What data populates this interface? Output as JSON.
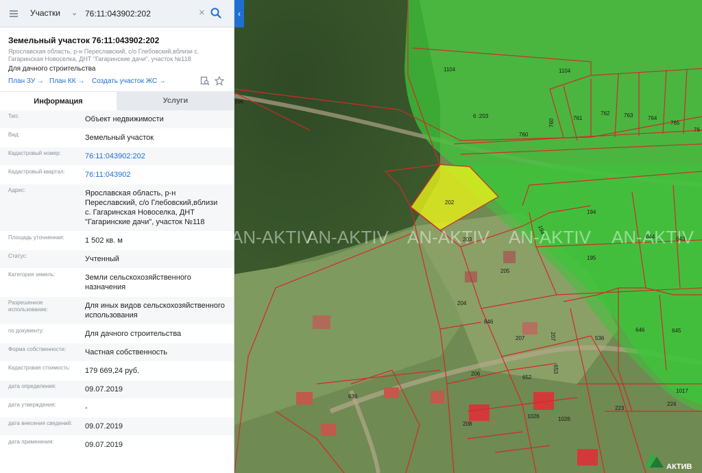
{
  "search": {
    "category": "Участки",
    "query": "76:11:043902:202"
  },
  "parcel": {
    "title": "Земельный участок 76:11:043902:202",
    "address_sub": "Ярославская область, р-н Переславский, с/о Глебовский,вблизи с. Гагаринская Новоселка, ДНТ \"Гагаринские дачи\", участок №118",
    "usage": "Для дачного строительства",
    "links": {
      "plan_zu": "План ЗУ →",
      "plan_kk": "План КК →",
      "create": "Создать участок ЖС →"
    }
  },
  "tabs": {
    "info": "Информация",
    "services": "Услуги"
  },
  "rows": [
    {
      "label": "Тип:",
      "value": "Объект недвижимости"
    },
    {
      "label": "Вид:",
      "value": "Земельный участок"
    },
    {
      "label": "Кадастровый номер:",
      "value": "76:11:043902:202"
    },
    {
      "label": "Кадастровый квартал:",
      "value": "76:11:043902"
    },
    {
      "label": "Адрес:",
      "value": "Ярославская область, р-н Переславский, с/о Глебовский,вблизи с. Гагаринская Новоселка, ДНТ \"Гагаринские дачи\", участок №118"
    },
    {
      "label": "Площадь уточненная:",
      "value": "1 502 кв. м"
    },
    {
      "label": "Статус:",
      "value": "Учтенный"
    },
    {
      "label": "Категория земель:",
      "value": "Земли сельскохозяйственного назначения"
    },
    {
      "label": "Разрешенное использование:",
      "value": "Для иных видов сельскохозяйственного использования"
    },
    {
      "label": "по документу:",
      "value": "Для дачного строительства"
    },
    {
      "label": "Форма собственности:",
      "value": "Частная собственность"
    },
    {
      "label": "Кадастровая стоимость:",
      "value": "179 669,24 руб."
    },
    {
      "label": "дата определения:",
      "value": "09.07.2019"
    },
    {
      "label": "дата утверждения:",
      "value": "-"
    },
    {
      "label": "дата внесения сведений:",
      "value": "09.07.2019"
    },
    {
      "label": "дата применения:",
      "value": "09.07.2019"
    }
  ],
  "map": {
    "watermark": "AN-AKTIV",
    "logo_text": "АКТИВ",
    "parcel_labels": [
      "1104",
      "1104",
      "6 :203",
      "760",
      "760",
      "761",
      "762",
      "763",
      "764",
      "765",
      "76",
      "996",
      "202",
      "203",
      "194",
      "194",
      "195",
      "644",
      "643",
      "205",
      "204",
      "846",
      "207",
      "207",
      "536",
      "646",
      "645",
      "206",
      "652",
      "653",
      "639",
      "1026",
      "1026",
      "208",
      "223",
      "224",
      "1017"
    ],
    "colors": {
      "zone_green": "#3ec43a",
      "selected": "#e8f21a",
      "border": "#d22a2a"
    }
  }
}
